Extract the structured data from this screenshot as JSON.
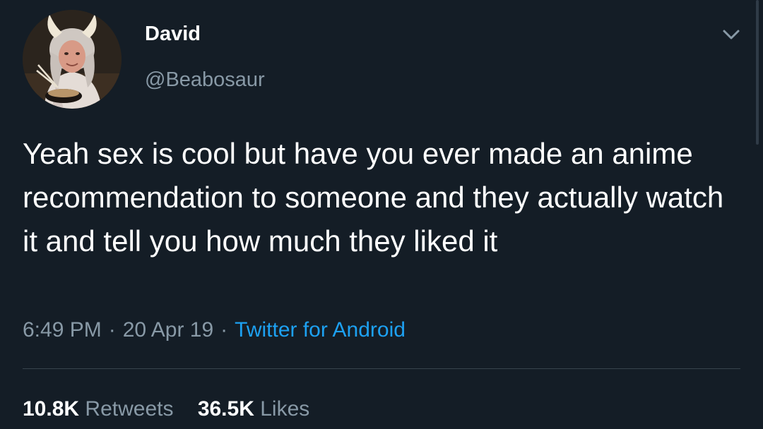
{
  "user": {
    "display_name": "David",
    "handle": "@Beabosaur",
    "avatar_icon": "profile-photo"
  },
  "tweet": {
    "text": "Yeah sex is cool but have you ever made an anime recommendation to someone and they actually watch it and tell you how much they liked it",
    "time": "6:49 PM",
    "date": "20 Apr 19",
    "source": "Twitter for Android",
    "separator": "·"
  },
  "stats": {
    "retweets_count": "10.8K",
    "retweets_label": "Retweets",
    "likes_count": "36.5K",
    "likes_label": "Likes"
  },
  "colors": {
    "background": "#141d26",
    "text": "#ffffff",
    "muted": "#8899a6",
    "link": "#1da1f2",
    "divider": "#38444d"
  },
  "icons": {
    "menu": "chevron-down-icon"
  }
}
